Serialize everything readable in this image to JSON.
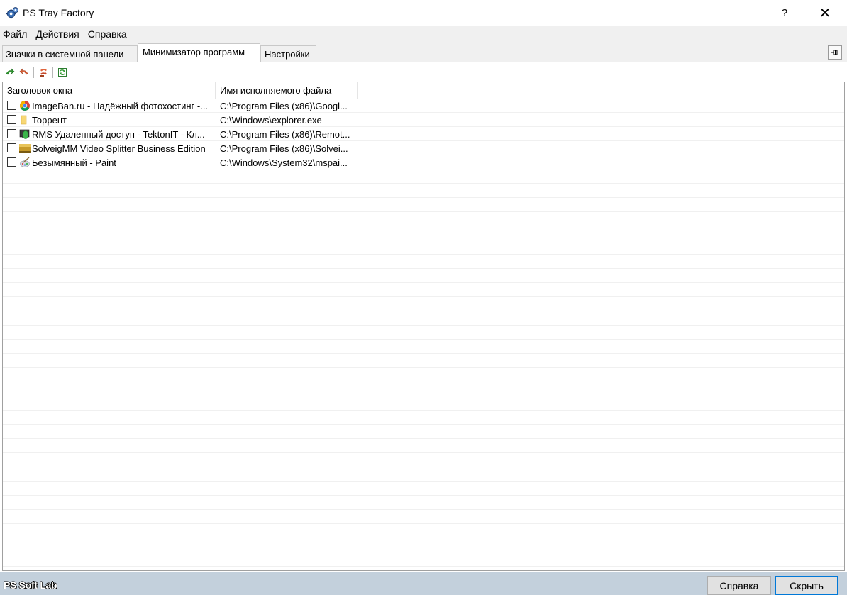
{
  "window": {
    "title": "PS Tray Factory",
    "help_glyph": "?",
    "close_glyph": "✕"
  },
  "menu": {
    "items": [
      {
        "label": "Файл"
      },
      {
        "label": "Действия"
      },
      {
        "label": "Справка"
      }
    ]
  },
  "tabs": [
    {
      "label": "Значки в системной панели",
      "active": false
    },
    {
      "label": "Минимизатор программ",
      "active": true
    },
    {
      "label": "Настройки",
      "active": false
    }
  ],
  "toolbar": {
    "icons": [
      "restore-arrow-icon",
      "minimize-arrow-icon",
      "multi-window-icon",
      "refresh-icon"
    ]
  },
  "list": {
    "columns": [
      "Заголовок окна",
      "Имя исполняемого файла"
    ],
    "rows": [
      {
        "title": "ImageBan.ru - Надёжный фотохостинг -...",
        "path": "C:\\Program Files (x86)\\Googl...",
        "icon": "chrome-icon",
        "checked": false
      },
      {
        "title": "Торрент",
        "path": "C:\\Windows\\explorer.exe",
        "icon": "folder-icon",
        "checked": false
      },
      {
        "title": "RMS Удаленный доступ - TektonIT - Кл...",
        "path": "C:\\Program Files (x86)\\Remot...",
        "icon": "rms-icon",
        "checked": false
      },
      {
        "title": "SolveigMM Video Splitter Business Edition",
        "path": "C:\\Program Files (x86)\\Solvei...",
        "icon": "video-splitter-icon",
        "checked": false
      },
      {
        "title": "Безымянный - Paint",
        "path": "C:\\Windows\\System32\\mspai...",
        "icon": "paint-icon",
        "checked": false
      }
    ]
  },
  "statusbar": {
    "brand": "PS Soft Lab",
    "help_button": "Справка",
    "hide_button": "Скрыть"
  },
  "colors": {
    "statusbar": "#c3d0dc",
    "focus_border": "#0078d7",
    "menubar": "#f0f0f0"
  }
}
